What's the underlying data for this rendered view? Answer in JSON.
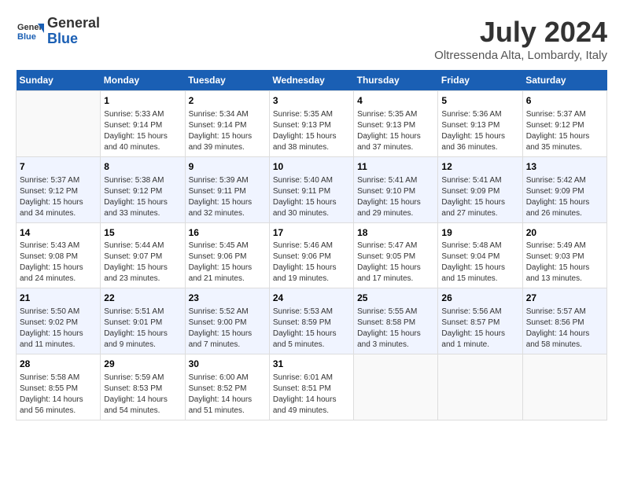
{
  "header": {
    "logo_line1": "General",
    "logo_line2": "Blue",
    "month_year": "July 2024",
    "location": "Oltressenda Alta, Lombardy, Italy"
  },
  "days_of_week": [
    "Sunday",
    "Monday",
    "Tuesday",
    "Wednesday",
    "Thursday",
    "Friday",
    "Saturday"
  ],
  "weeks": [
    [
      {
        "day": "",
        "content": ""
      },
      {
        "day": "1",
        "content": "Sunrise: 5:33 AM\nSunset: 9:14 PM\nDaylight: 15 hours\nand 40 minutes."
      },
      {
        "day": "2",
        "content": "Sunrise: 5:34 AM\nSunset: 9:14 PM\nDaylight: 15 hours\nand 39 minutes."
      },
      {
        "day": "3",
        "content": "Sunrise: 5:35 AM\nSunset: 9:13 PM\nDaylight: 15 hours\nand 38 minutes."
      },
      {
        "day": "4",
        "content": "Sunrise: 5:35 AM\nSunset: 9:13 PM\nDaylight: 15 hours\nand 37 minutes."
      },
      {
        "day": "5",
        "content": "Sunrise: 5:36 AM\nSunset: 9:13 PM\nDaylight: 15 hours\nand 36 minutes."
      },
      {
        "day": "6",
        "content": "Sunrise: 5:37 AM\nSunset: 9:12 PM\nDaylight: 15 hours\nand 35 minutes."
      }
    ],
    [
      {
        "day": "7",
        "content": "Sunrise: 5:37 AM\nSunset: 9:12 PM\nDaylight: 15 hours\nand 34 minutes."
      },
      {
        "day": "8",
        "content": "Sunrise: 5:38 AM\nSunset: 9:12 PM\nDaylight: 15 hours\nand 33 minutes."
      },
      {
        "day": "9",
        "content": "Sunrise: 5:39 AM\nSunset: 9:11 PM\nDaylight: 15 hours\nand 32 minutes."
      },
      {
        "day": "10",
        "content": "Sunrise: 5:40 AM\nSunset: 9:11 PM\nDaylight: 15 hours\nand 30 minutes."
      },
      {
        "day": "11",
        "content": "Sunrise: 5:41 AM\nSunset: 9:10 PM\nDaylight: 15 hours\nand 29 minutes."
      },
      {
        "day": "12",
        "content": "Sunrise: 5:41 AM\nSunset: 9:09 PM\nDaylight: 15 hours\nand 27 minutes."
      },
      {
        "day": "13",
        "content": "Sunrise: 5:42 AM\nSunset: 9:09 PM\nDaylight: 15 hours\nand 26 minutes."
      }
    ],
    [
      {
        "day": "14",
        "content": "Sunrise: 5:43 AM\nSunset: 9:08 PM\nDaylight: 15 hours\nand 24 minutes."
      },
      {
        "day": "15",
        "content": "Sunrise: 5:44 AM\nSunset: 9:07 PM\nDaylight: 15 hours\nand 23 minutes."
      },
      {
        "day": "16",
        "content": "Sunrise: 5:45 AM\nSunset: 9:06 PM\nDaylight: 15 hours\nand 21 minutes."
      },
      {
        "day": "17",
        "content": "Sunrise: 5:46 AM\nSunset: 9:06 PM\nDaylight: 15 hours\nand 19 minutes."
      },
      {
        "day": "18",
        "content": "Sunrise: 5:47 AM\nSunset: 9:05 PM\nDaylight: 15 hours\nand 17 minutes."
      },
      {
        "day": "19",
        "content": "Sunrise: 5:48 AM\nSunset: 9:04 PM\nDaylight: 15 hours\nand 15 minutes."
      },
      {
        "day": "20",
        "content": "Sunrise: 5:49 AM\nSunset: 9:03 PM\nDaylight: 15 hours\nand 13 minutes."
      }
    ],
    [
      {
        "day": "21",
        "content": "Sunrise: 5:50 AM\nSunset: 9:02 PM\nDaylight: 15 hours\nand 11 minutes."
      },
      {
        "day": "22",
        "content": "Sunrise: 5:51 AM\nSunset: 9:01 PM\nDaylight: 15 hours\nand 9 minutes."
      },
      {
        "day": "23",
        "content": "Sunrise: 5:52 AM\nSunset: 9:00 PM\nDaylight: 15 hours\nand 7 minutes."
      },
      {
        "day": "24",
        "content": "Sunrise: 5:53 AM\nSunset: 8:59 PM\nDaylight: 15 hours\nand 5 minutes."
      },
      {
        "day": "25",
        "content": "Sunrise: 5:55 AM\nSunset: 8:58 PM\nDaylight: 15 hours\nand 3 minutes."
      },
      {
        "day": "26",
        "content": "Sunrise: 5:56 AM\nSunset: 8:57 PM\nDaylight: 15 hours\nand 1 minute."
      },
      {
        "day": "27",
        "content": "Sunrise: 5:57 AM\nSunset: 8:56 PM\nDaylight: 14 hours\nand 58 minutes."
      }
    ],
    [
      {
        "day": "28",
        "content": "Sunrise: 5:58 AM\nSunset: 8:55 PM\nDaylight: 14 hours\nand 56 minutes."
      },
      {
        "day": "29",
        "content": "Sunrise: 5:59 AM\nSunset: 8:53 PM\nDaylight: 14 hours\nand 54 minutes."
      },
      {
        "day": "30",
        "content": "Sunrise: 6:00 AM\nSunset: 8:52 PM\nDaylight: 14 hours\nand 51 minutes."
      },
      {
        "day": "31",
        "content": "Sunrise: 6:01 AM\nSunset: 8:51 PM\nDaylight: 14 hours\nand 49 minutes."
      },
      {
        "day": "",
        "content": ""
      },
      {
        "day": "",
        "content": ""
      },
      {
        "day": "",
        "content": ""
      }
    ]
  ]
}
